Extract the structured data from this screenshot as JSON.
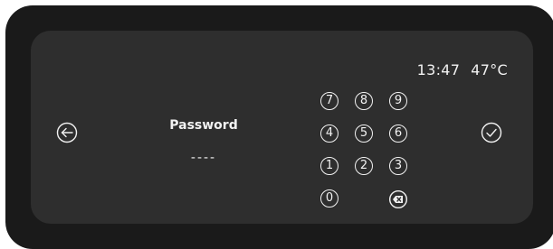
{
  "status": {
    "time": "13:47",
    "temperature": "47°C"
  },
  "password": {
    "label": "Password",
    "masked_value": "----"
  },
  "keypad": {
    "keys": [
      "7",
      "8",
      "9",
      "4",
      "5",
      "6",
      "1",
      "2",
      "3",
      "0"
    ]
  },
  "icons": {
    "back": "back-arrow-icon",
    "confirm": "checkmark-icon",
    "delete": "backspace-icon"
  },
  "colors": {
    "bezel": "#1a1a1a",
    "screen": "#2e2e2e",
    "foreground": "#f2f2f2"
  }
}
